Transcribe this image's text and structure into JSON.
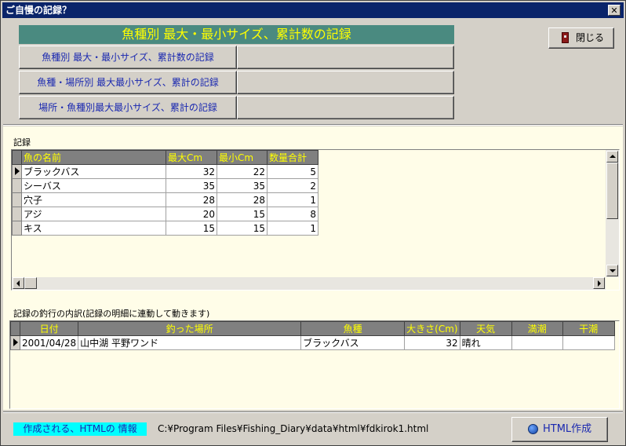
{
  "window": {
    "title": "ご自慢の記録？",
    "close_glyph": "✕"
  },
  "header": {
    "banner": "魚種別 最大・最小サイズ、累計数の記録"
  },
  "nav": [
    {
      "label": "魚種別 最大・最小サイズ、累計数の記録"
    },
    {
      "label": "魚種・場所別 最大最小サイズ、累計の記録"
    },
    {
      "label": "場所・魚種別最大最小サイズ、累計の記録"
    }
  ],
  "close_button": {
    "label": "閉じる",
    "icon": "door-icon"
  },
  "records": {
    "section_label": "記録",
    "columns": [
      "魚の名前",
      "最大Cm",
      "最小Cm",
      "数量合計"
    ],
    "rows": [
      {
        "name": "ブラックバス",
        "max": "32",
        "min": "22",
        "count": "5"
      },
      {
        "name": "シーバス",
        "max": "35",
        "min": "35",
        "count": "2"
      },
      {
        "name": "穴子",
        "max": "28",
        "min": "28",
        "count": "1"
      },
      {
        "name": "アジ",
        "max": "20",
        "min": "15",
        "count": "8"
      },
      {
        "name": "キス",
        "max": "15",
        "min": "15",
        "count": "1"
      }
    ],
    "selected_row": 0
  },
  "details": {
    "section_label": "記録の釣行の内訳(記録の明細に連動して動きます)",
    "columns": [
      "日付",
      "釣った場所",
      "魚種",
      "大きさ(Cm)",
      "天気",
      "満潮",
      "干潮"
    ],
    "rows": [
      {
        "date": "2001/04/28",
        "place": "山中湖 平野ワンド",
        "fish": "ブラックバス",
        "size": "32",
        "weather": "晴れ",
        "high_tide": "",
        "low_tide": ""
      }
    ]
  },
  "footer": {
    "info_label": "作成される、HTMLの 情報",
    "path": "C:¥Program Files¥Fishing_Diary¥data¥html¥fdkirok1.html",
    "html_button": "HTML作成",
    "html_icon": "globe-icon"
  }
}
